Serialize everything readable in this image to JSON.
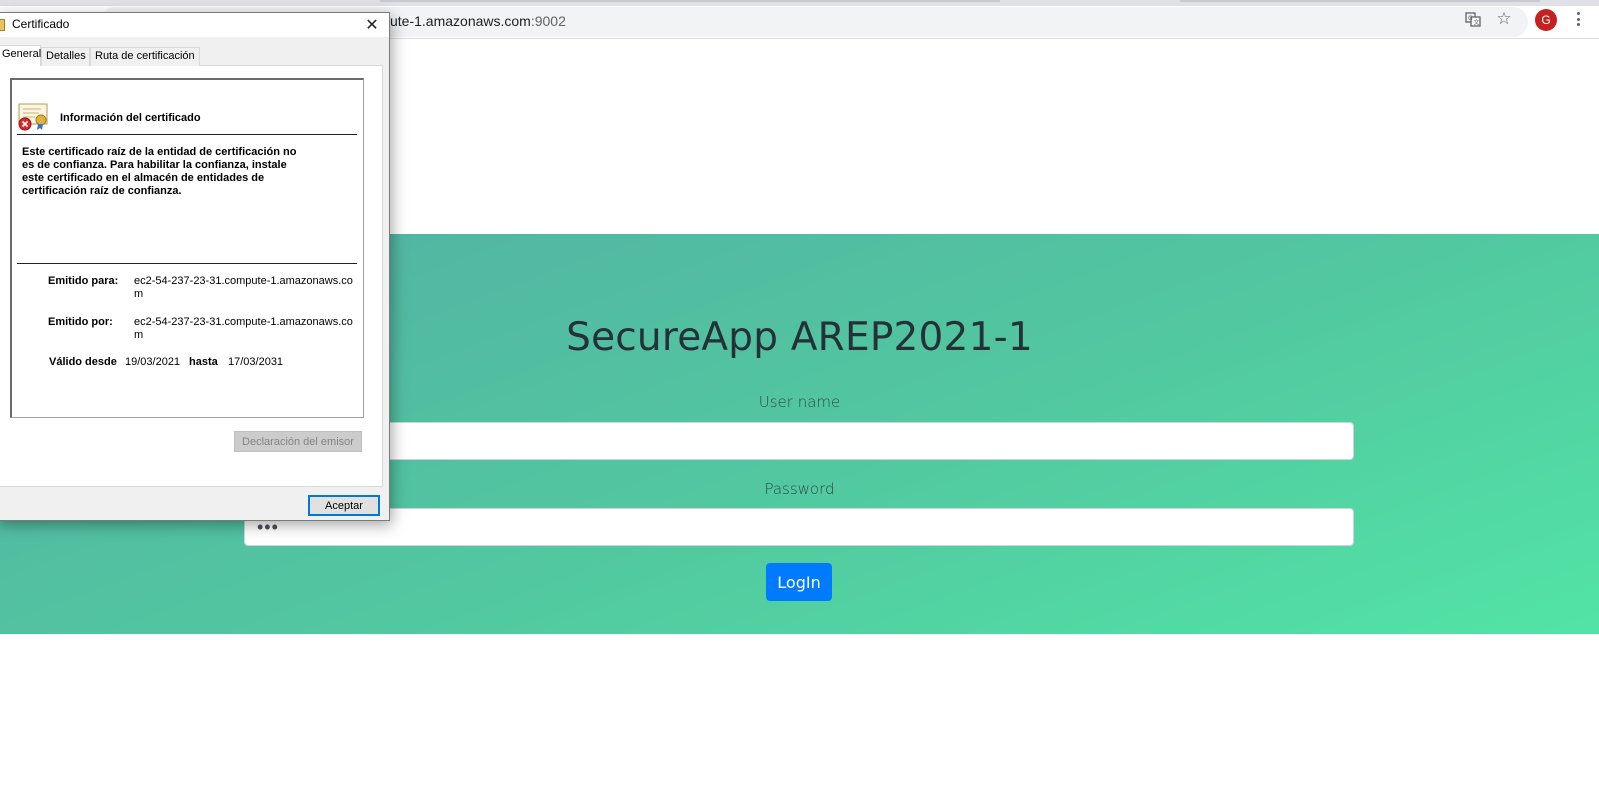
{
  "browser": {
    "url_main": "ute-1.amazonaws.com",
    "url_port": ":9002",
    "translate_icon": "translate-icon",
    "bookmark_icon": "star-icon",
    "profile_initial": "G",
    "menu_icon": "kebab-menu-icon"
  },
  "page": {
    "title": "SecureApp AREP2021-1",
    "username_label": "User name",
    "username_value": "",
    "password_label": "Password",
    "password_value": "•••",
    "login_button": "LogIn",
    "colors": {
      "hero_gradient_start": "#52b0a3",
      "hero_gradient_end": "#52e4a6",
      "primary_button": "#007bff"
    }
  },
  "dialog": {
    "title": "Certificado",
    "close_icon": "close-icon",
    "tabs": [
      {
        "label": "General",
        "active": true
      },
      {
        "label": "Detalles",
        "active": false
      },
      {
        "label": "Ruta de certificación",
        "active": false
      }
    ],
    "info_title": "Información del certificado",
    "warning_lines": [
      "Este certificado raíz de la entidad de certificación no",
      "es de confianza. Para habilitar la confianza, instale",
      "este certificado en el almacén de entidades de",
      "certificación raíz de confianza."
    ],
    "issued_to_label": "Emitido para:",
    "issued_to_value": "ec2-54-237-23-31.compute-1.amazonaws.com",
    "issued_by_label": "Emitido por:",
    "issued_by_value": "ec2-54-237-23-31.compute-1.amazonaws.com",
    "valid_from_label": "Válido desde",
    "valid_from_value": "19/03/2021",
    "valid_to_label": "hasta",
    "valid_to_value": "17/03/2031",
    "issuer_statement_button": "Declaración del emisor",
    "ok_button": "Aceptar"
  }
}
